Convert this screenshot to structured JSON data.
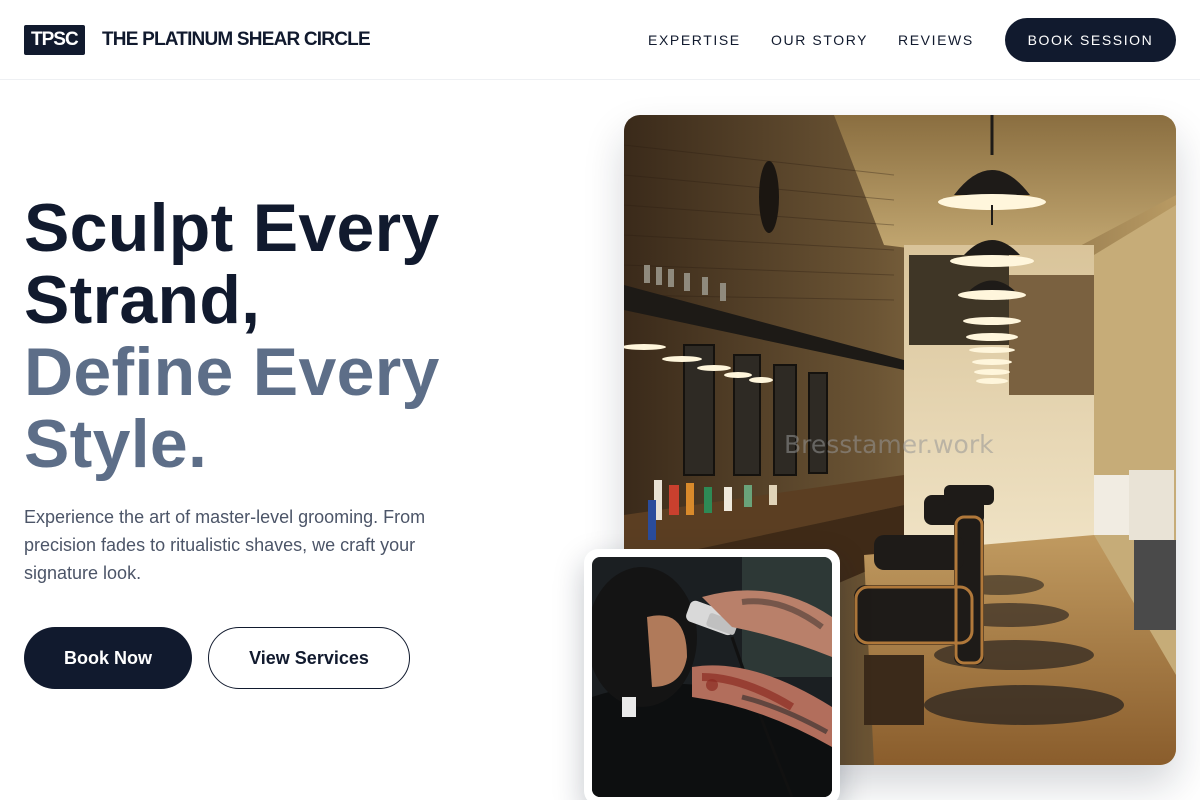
{
  "header": {
    "logo_badge": "TPSC",
    "brand_name": "THE PLATINUM SHEAR CIRCLE",
    "nav": [
      "EXPERTISE",
      "OUR STORY",
      "REVIEWS"
    ],
    "cta": "BOOK SESSION"
  },
  "hero": {
    "title_line1": "Sculpt Every",
    "title_line2": "Strand,",
    "title_line3": "Define Every",
    "title_line4": "Style.",
    "subtitle": "Experience the art of master-level grooming. From precision fades to ritualistic shaves, we craft your signature look.",
    "primary_button": "Book Now",
    "secondary_button": "View Services"
  },
  "images": {
    "main_watermark": "Bresstamer.work"
  },
  "colors": {
    "navy": "#111a2e",
    "slate": "#5d6e88",
    "body_text": "#4c5568"
  }
}
